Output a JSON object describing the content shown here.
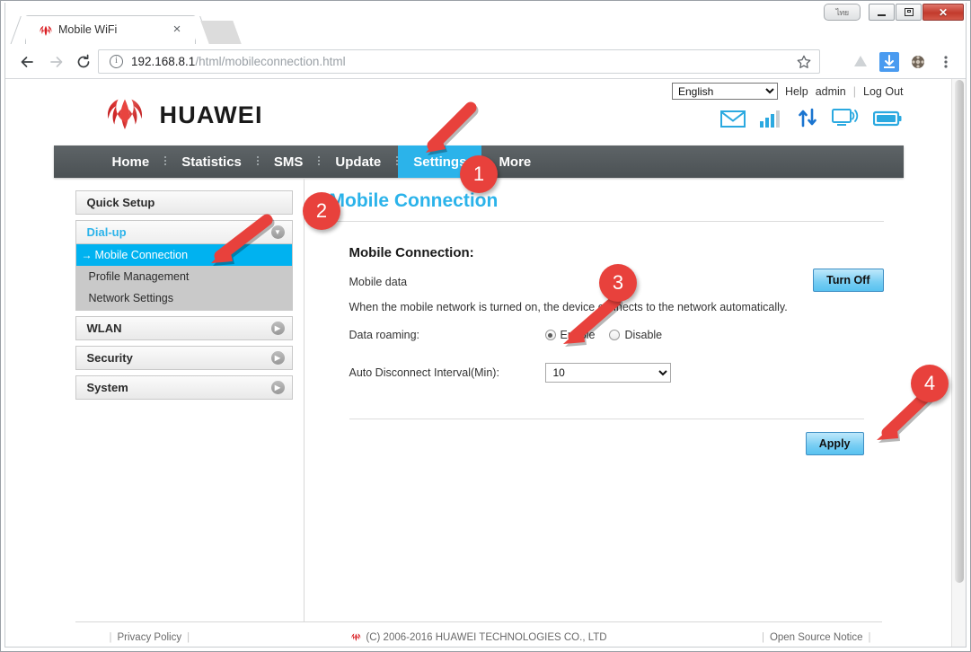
{
  "browser": {
    "tab": {
      "title": "Mobile WiFi",
      "favicon": "huawei-flower-icon",
      "close": "×"
    },
    "window_controls": {
      "lang_button": "ไทย",
      "minimize": "minimize-icon",
      "maximize": "maximize-icon",
      "close": "✕"
    },
    "omnibox": {
      "url_host": "192.168.8.1",
      "url_path": "/html/mobileconnection.html",
      "info_icon": "i",
      "star_icon": "bookmark-star-icon"
    },
    "toolbar_icons": [
      "back-arrow-icon",
      "forward-arrow-icon",
      "reload-icon",
      "google-drive-icon",
      "download-icon",
      "extension-icon",
      "chrome-menu-icon"
    ]
  },
  "header": {
    "logo_text": "HUAWEI",
    "language": "English",
    "language_options": [
      "English"
    ],
    "help": "Help",
    "user": "admin",
    "logout": "Log Out",
    "status_icons": [
      "message-icon",
      "signal-bars-icon",
      "data-transfer-icon",
      "wifi-monitor-icon",
      "battery-icon"
    ]
  },
  "nav": {
    "items": [
      {
        "label": "Home",
        "active": false
      },
      {
        "label": "Statistics",
        "active": false
      },
      {
        "label": "SMS",
        "active": false
      },
      {
        "label": "Update",
        "active": false
      },
      {
        "label": "Settings",
        "active": true
      },
      {
        "label": "More",
        "active": false
      }
    ]
  },
  "sidebar": {
    "quick_setup": "Quick Setup",
    "dialup": "Dial-up",
    "dialup_items": [
      {
        "label": "Mobile Connection",
        "active": true
      },
      {
        "label": "Profile Management",
        "active": false
      },
      {
        "label": "Network Settings",
        "active": false
      }
    ],
    "wlan": "WLAN",
    "security": "Security",
    "system": "System"
  },
  "content": {
    "title": "Mobile Connection",
    "section_title": "Mobile Connection:",
    "mobile_data_label": "Mobile data",
    "turn_off_button": "Turn Off",
    "hint": "When the mobile network is turned on, the device connects to the network automatically.",
    "data_roaming_label": "Data roaming:",
    "roaming_enable": "Enable",
    "roaming_disable": "Disable",
    "roaming_selected": "Enable",
    "interval_label": "Auto Disconnect Interval(Min):",
    "interval_value": "10",
    "interval_options": [
      "10"
    ],
    "apply_button": "Apply"
  },
  "footer": {
    "privacy_policy": "Privacy Policy",
    "copyright": "(C) 2006-2016 HUAWEI TECHNOLOGIES CO., LTD",
    "open_source": "Open Source Notice",
    "bar": "|"
  },
  "annotations": {
    "badges": [
      {
        "number": "1"
      },
      {
        "number": "2"
      },
      {
        "number": "3"
      },
      {
        "number": "4"
      }
    ],
    "accent_color": "#e8413c"
  }
}
